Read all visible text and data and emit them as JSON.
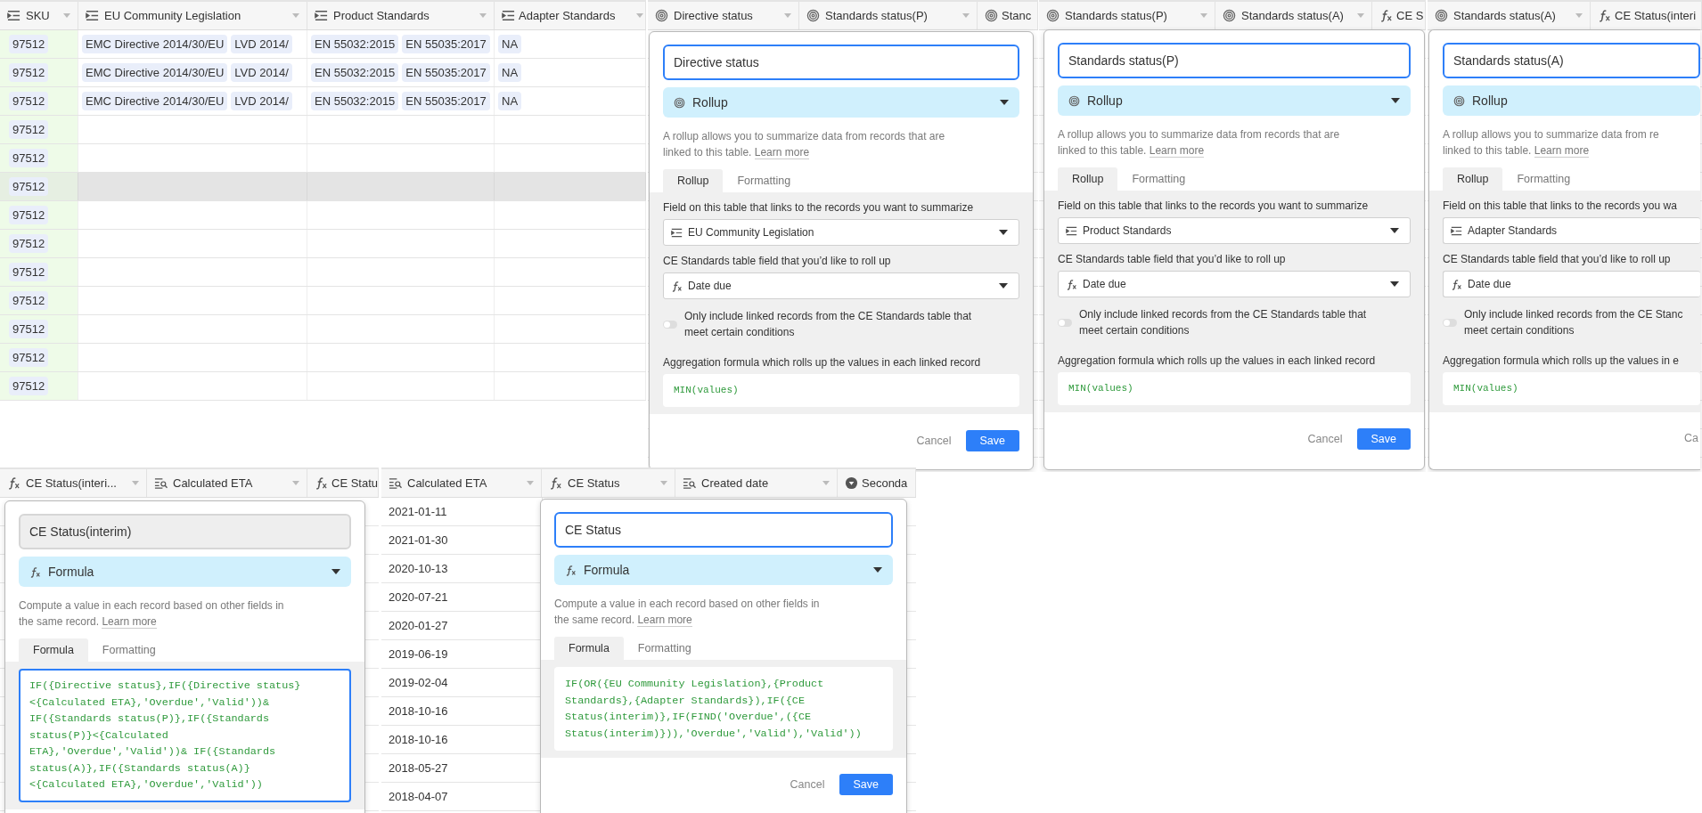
{
  "grid": {
    "columns": [
      {
        "label": "SKU",
        "kind": "link"
      },
      {
        "label": "EU Community Legislation",
        "kind": "link"
      },
      {
        "label": "Product Standards",
        "kind": "link"
      },
      {
        "label": "Adapter Standards",
        "kind": "link"
      }
    ],
    "rows": [
      {
        "hovered": false,
        "cells": [
          [
            "97512"
          ],
          [
            "EMC Directive 2014/30/EU",
            "LVD 2014/"
          ],
          [
            "EN 55032:2015",
            "EN 55035:2017"
          ],
          [
            "NA"
          ]
        ]
      },
      {
        "hovered": false,
        "cells": [
          [
            "97512"
          ],
          [
            "EMC Directive 2014/30/EU",
            "LVD 2014/"
          ],
          [
            "EN 55032:2015",
            "EN 55035:2017"
          ],
          [
            "NA"
          ]
        ]
      },
      {
        "hovered": false,
        "cells": [
          [
            "97512"
          ],
          [
            "EMC Directive 2014/30/EU",
            "LVD 2014/"
          ],
          [
            "EN 55032:2015",
            "EN 55035:2017"
          ],
          [
            "NA"
          ]
        ]
      },
      {
        "hovered": false,
        "cells": [
          [
            "97512"
          ]
        ]
      },
      {
        "hovered": false,
        "cells": [
          [
            "97512"
          ]
        ]
      },
      {
        "hovered": true,
        "cells": [
          [
            "97512"
          ]
        ]
      },
      {
        "hovered": false,
        "cells": [
          [
            "97512"
          ]
        ]
      },
      {
        "hovered": false,
        "cells": [
          [
            "97512"
          ]
        ]
      },
      {
        "hovered": false,
        "cells": [
          [
            "97512"
          ]
        ]
      },
      {
        "hovered": false,
        "cells": [
          [
            "97512"
          ]
        ]
      },
      {
        "hovered": false,
        "cells": [
          [
            "97512"
          ]
        ]
      },
      {
        "hovered": false,
        "cells": [
          [
            "97512"
          ]
        ]
      },
      {
        "hovered": false,
        "cells": [
          [
            "97512"
          ]
        ]
      }
    ]
  },
  "dialog_panels": [
    {
      "columns": [
        {
          "label": "Directive status",
          "kind": "rollup"
        },
        {
          "label": "Standards status(P)",
          "kind": "rollup"
        },
        {
          "label": "Stanc",
          "kind": "rollup"
        }
      ],
      "dialog": {
        "kind": "rollup",
        "clipped": false,
        "name": {
          "value": "Directive status",
          "focused": true
        },
        "field_type": {
          "label": "Rollup",
          "kind": "rollup"
        },
        "description": {
          "lines": [
            "A rollup allows you to summarize data from records that are",
            "linked to this table."
          ],
          "link": "Learn more"
        },
        "tabs": [
          {
            "label": "Rollup",
            "selected": true
          },
          {
            "label": "Formatting",
            "selected": false
          }
        ],
        "link_label": "Field on this table that links to the records you want to summarize",
        "link_field": {
          "label": "EU Community Legislation",
          "kind": "link"
        },
        "rollup_label": "CE Standards table field that you’d like to roll up",
        "rollup_field": {
          "label": "Date due",
          "kind": "formula"
        },
        "condition": {
          "on": false,
          "lines": [
            "Only include linked records from the CE Standards table that",
            "meet certain conditions"
          ]
        },
        "aggregation_label": "Aggregation formula which rolls up the values in each linked record",
        "code": {
          "lines": [
            "MIN(values)"
          ],
          "focused": false
        },
        "cancel": "Cancel",
        "save": "Save"
      }
    },
    {
      "columns": [
        {
          "label": "Standards status(P)",
          "kind": "rollup"
        },
        {
          "label": "Standards status(A)",
          "kind": "rollup"
        },
        {
          "label": "CE S",
          "kind": "formula"
        }
      ],
      "dialog": {
        "kind": "rollup",
        "clipped": false,
        "name": {
          "value": "Standards status(P)",
          "focused": true
        },
        "field_type": {
          "label": "Rollup",
          "kind": "rollup"
        },
        "description": {
          "lines": [
            "A rollup allows you to summarize data from records that are",
            "linked to this table."
          ],
          "link": "Learn more"
        },
        "tabs": [
          {
            "label": "Rollup",
            "selected": true
          },
          {
            "label": "Formatting",
            "selected": false
          }
        ],
        "link_label": "Field on this table that links to the records you want to summarize",
        "link_field": {
          "label": "Product Standards",
          "kind": "link"
        },
        "rollup_label": "CE Standards table field that you’d like to roll up",
        "rollup_field": {
          "label": "Date due",
          "kind": "formula"
        },
        "condition": {
          "on": false,
          "lines": [
            "Only include linked records from the CE Standards table that",
            "meet certain conditions"
          ]
        },
        "aggregation_label": "Aggregation formula which rolls up the values in each linked record",
        "code": {
          "lines": [
            "MIN(values)"
          ],
          "focused": false
        },
        "cancel": "Cancel",
        "save": "Save"
      }
    },
    {
      "columns": [
        {
          "label": "Standards status(A)",
          "kind": "rollup"
        },
        {
          "label": "CE Status(interi",
          "kind": "formula"
        }
      ],
      "dialog": {
        "kind": "rollup",
        "clipped": true,
        "name": {
          "value": "Standards status(A)",
          "focused": true
        },
        "field_type": {
          "label": "Rollup",
          "kind": "rollup"
        },
        "description": {
          "lines": [
            "A rollup allows you to summarize data from re",
            "linked to this table."
          ],
          "link": "Learn more"
        },
        "tabs": [
          {
            "label": "Rollup",
            "selected": true
          },
          {
            "label": "Formatting",
            "selected": false
          }
        ],
        "link_label": "Field on this table that links to the records you wa",
        "link_field": {
          "label": "Adapter Standards",
          "kind": "link"
        },
        "rollup_label": "CE Standards table field that you’d like to roll up",
        "rollup_field": {
          "label": "Date due",
          "kind": "formula"
        },
        "condition": {
          "on": false,
          "lines": [
            "Only include linked records from the CE Stanc",
            "meet certain conditions"
          ]
        },
        "aggregation_label": "Aggregation formula which rolls up the values in e",
        "code": {
          "lines": [
            "MIN(values)"
          ],
          "focused": false
        },
        "cancel": "Ca"
      }
    },
    {
      "columns": [
        {
          "label": "CE Status(interi...",
          "kind": "formula"
        },
        {
          "label": "Calculated ETA",
          "kind": "lookup"
        },
        {
          "label": "CE Statu",
          "kind": "formula"
        }
      ],
      "dialog": {
        "kind": "formula",
        "clipped": false,
        "name": {
          "value": "CE Status(interim)",
          "focused": false
        },
        "field_type": {
          "label": "Formula",
          "kind": "formula"
        },
        "description": {
          "lines": [
            "Compute a value in each record based on other fields in",
            "the same record."
          ],
          "link": "Learn more"
        },
        "tabs": [
          {
            "label": "Formula",
            "selected": true
          },
          {
            "label": "Formatting",
            "selected": false
          }
        ],
        "code": {
          "focused": true,
          "lines": [
            "IF({Directive status},IF({Directive status}",
            "<{Calculated ETA},'Overdue','Valid'))&",
            "IF({Standards status(P)},IF({Standards",
            "status(P)}<{Calculated",
            "ETA},'Overdue','Valid'))& IF({Standards",
            "status(A)},IF({Standards status(A)}",
            "<{Calculated ETA},'Overdue','Valid'))"
          ]
        }
      }
    },
    {
      "columns": [
        {
          "label": "Calculated ETA",
          "kind": "lookup"
        },
        {
          "label": "CE Status",
          "kind": "formula"
        },
        {
          "label": "Created date",
          "kind": "lookup"
        },
        {
          "label": "Seconda",
          "kind": "select"
        }
      ],
      "dates": [
        "2021-01-11",
        "2021-01-30",
        "2020-10-13",
        "2020-07-21",
        "2020-01-27",
        "2019-06-19",
        "2019-02-04",
        "2018-10-16",
        "2018-10-16",
        "2018-05-27",
        "2018-04-07"
      ],
      "dialog": {
        "kind": "formula",
        "clipped": false,
        "name": {
          "value": "CE Status",
          "focused": true
        },
        "field_type": {
          "label": "Formula",
          "kind": "formula"
        },
        "description": {
          "lines": [
            "Compute a value in each record based on other fields in",
            "the same record."
          ],
          "link": "Learn more"
        },
        "tabs": [
          {
            "label": "Formula",
            "selected": true
          },
          {
            "label": "Formatting",
            "selected": false
          }
        ],
        "code": {
          "focused": false,
          "lines": [
            "IF(OR({EU Community Legislation},{Product",
            "Standards},{Adapter Standards}),IF({CE",
            "Status(interim)},IF(FIND('Overdue',({CE",
            "Status(interim)})),'Overdue','Valid'),'Valid'))"
          ]
        },
        "cancel": "Cancel",
        "save": "Save"
      }
    }
  ]
}
